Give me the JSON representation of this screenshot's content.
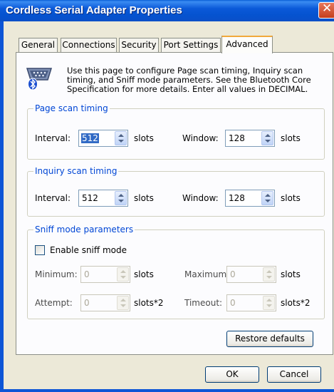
{
  "window": {
    "title": "Cordless Serial Adapter Properties",
    "close_glyph": "✕"
  },
  "tabs": [
    "General",
    "Connections",
    "Security",
    "Port Settings",
    "Advanced"
  ],
  "active_tab": "Advanced",
  "description": "Use this page to configure Page scan timing, Inquiry scan timing, and Sniff mode parameters. See the Bluetooth Core Specification for more details. Enter all values in DECIMAL.",
  "page_scan": {
    "title": "Page scan timing",
    "interval_label": "Interval:",
    "interval": "512",
    "interval_unit": "slots",
    "window_label": "Window:",
    "window": "128",
    "window_unit": "slots"
  },
  "inquiry_scan": {
    "title": "Inquiry scan timing",
    "interval_label": "Interval:",
    "interval": "512",
    "interval_unit": "slots",
    "window_label": "Window:",
    "window": "128",
    "window_unit": "slots"
  },
  "sniff": {
    "title": "Sniff mode parameters",
    "enable_label": "Enable sniff mode",
    "enabled": false,
    "minimum_label": "Minimum:",
    "minimum": "0",
    "minimum_unit": "slots",
    "maximum_label": "Maximum:",
    "maximum": "0",
    "maximum_unit": "slots",
    "attempt_label": "Attempt:",
    "attempt": "0",
    "attempt_unit": "slots*2",
    "timeout_label": "Timeout:",
    "timeout": "0",
    "timeout_unit": "slots*2"
  },
  "buttons": {
    "restore": "Restore defaults",
    "ok": "OK",
    "cancel": "Cancel"
  },
  "colors": {
    "titlebar": "#0553d0",
    "group_title": "#0046d5",
    "active_tab_accent": "#f1a93b"
  }
}
